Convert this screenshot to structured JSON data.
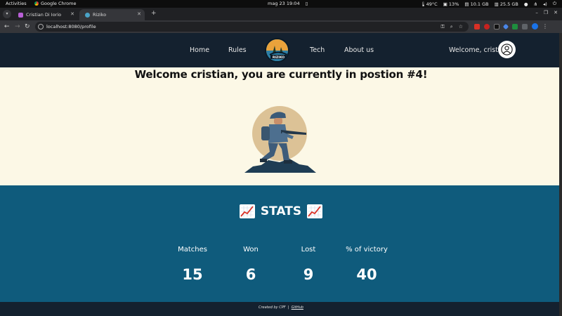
{
  "os_bar": {
    "activities": "Activities",
    "app_name": "Google Chrome",
    "clock": "mag 23  19:04",
    "temperature": "49°C",
    "cpu": "13%",
    "memory": "10.1 GB",
    "disk": "25.5 GB"
  },
  "browser": {
    "tabs": [
      {
        "title": "Cristian Di Iorio",
        "favicon_color": "#b85fd6"
      },
      {
        "title": "Riziko",
        "favicon_color": "#4aa3c7"
      }
    ],
    "url": "localhost:8080/profile"
  },
  "site": {
    "nav": {
      "home": "Home",
      "rules": "Rules",
      "tech": "Tech",
      "about": "About us",
      "logo_text": "RIZIKO",
      "welcome_user": "Welcome, cristi..."
    },
    "headline": "Welcome cristian, you are currently in postion #4!",
    "stats": {
      "title": "STATS",
      "items": [
        {
          "label": "Matches",
          "value": "15"
        },
        {
          "label": "Won",
          "value": "6"
        },
        {
          "label": "Lost",
          "value": "9"
        },
        {
          "label": "% of victory",
          "value": "40"
        }
      ]
    },
    "footer": {
      "created_by": "Created by CPF",
      "separator": "|",
      "github": "GitHub"
    }
  },
  "colors": {
    "nav_bg": "#14212f",
    "page_bg": "#fcf8e6",
    "stats_bg": "#0f5b7c"
  }
}
